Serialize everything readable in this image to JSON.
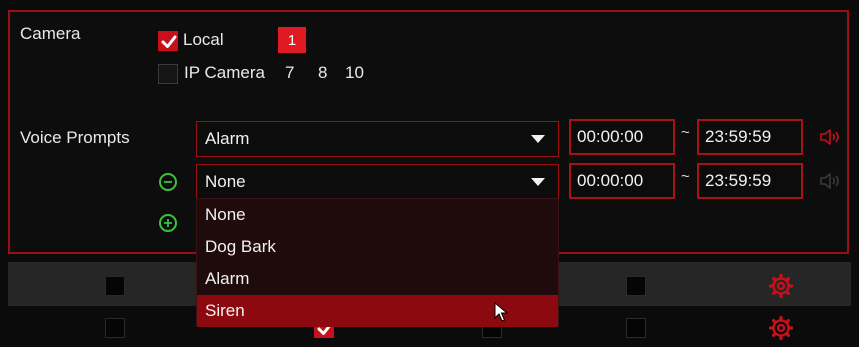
{
  "camera": {
    "label": "Camera",
    "local": {
      "label": "Local",
      "checked": true,
      "badge": "1"
    },
    "ip_camera": {
      "label": "IP Camera",
      "checked": false,
      "channels": [
        "7",
        "8",
        "10"
      ]
    }
  },
  "voice_prompts": {
    "label": "Voice Prompts",
    "rows": [
      {
        "value": "Alarm",
        "start": "00:00:00",
        "separator": "~",
        "end": "23:59:59",
        "speaker": "active"
      },
      {
        "value": "None",
        "start": "00:00:00",
        "separator": "~",
        "end": "23:59:59",
        "speaker": "inactive"
      }
    ]
  },
  "dropdown": {
    "options": [
      "None",
      "Dog Bark",
      "Alarm",
      "Siren"
    ],
    "highlighted": "Siren"
  },
  "colors": {
    "accent": "#c8101a",
    "border": "#9a0e14",
    "green": "#3cc23c",
    "highlight": "#8c0a0f"
  },
  "icons": {
    "remove": "minus-circle-icon",
    "add": "plus-circle-icon",
    "speaker": "speaker-icon",
    "settings": "gear-icon",
    "dropdown": "caret-down-icon"
  }
}
